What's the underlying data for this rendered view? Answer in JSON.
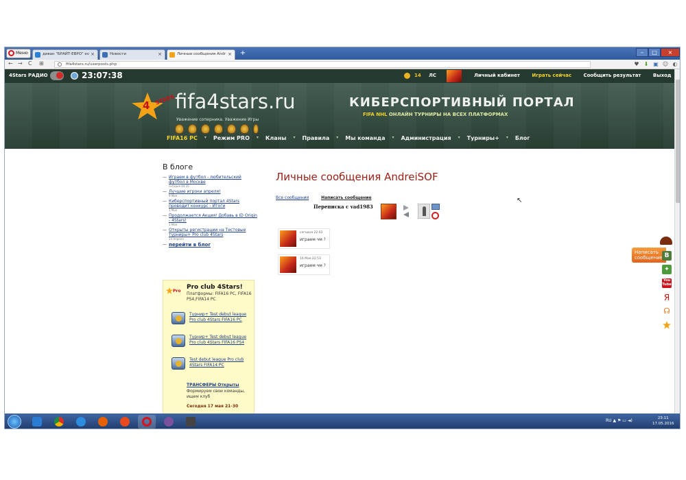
{
  "browser": {
    "menu_label": "Меню",
    "tabs": [
      {
        "label": "диван \"БРАЙТ-ЕВРО\" ev"
      },
      {
        "label": "Новости"
      },
      {
        "label": "Личные сообщения Andr"
      }
    ],
    "url": "fifa4stars.ru/userposts.php"
  },
  "topbar": {
    "radio_label": "4Stars РАДИО",
    "time": "23:07:38",
    "coins": "14",
    "messages_label": "ЛС",
    "links": [
      "Личный кабинет",
      "Играть сейчас",
      "Сообщить результат",
      "Выход"
    ]
  },
  "header": {
    "logo_number": "4",
    "logo_word": "STARS",
    "brand": "fifa4stars.ru",
    "slogan": "Уважение соперника. Уважение Игры",
    "portal_title": "КИБЕРСПОРТИВНЫЙ ПОРТАЛ",
    "portal_sub_a": "FIFA",
    "portal_sub_b": "NHL",
    "portal_sub_c": "ОНЛАЙН ТУРНИРЫ НА ВСЕХ ПЛАТФОРМАХ"
  },
  "nav": {
    "items": [
      "FIFA16 PC",
      "Режим PRO",
      "Кланы",
      "Правила",
      "Мы команда",
      "Администрация",
      "Турниры+",
      "Блог"
    ]
  },
  "blog": {
    "heading": "В блоге",
    "items": [
      {
        "title": "Играем в футбол - любительский футбол в Москве",
        "date": "сегодня 04:35"
      },
      {
        "title": "Лучшие игроки апреля!",
        "date": "9 Мая"
      },
      {
        "title": "Киберспортивный портал 4Stars проводит конкурс - Итоги",
        "date": "3 Мая"
      },
      {
        "title": "Продолжается Акция! Добавь в ID Origin - 4Stars!",
        "date": "1 Мая"
      },
      {
        "title": "Открыты регистрации на Тестовые турниры+ Pro club 4Stars",
        "date": "24 Апреля"
      }
    ],
    "all_link": "перейти в блог"
  },
  "proclub": {
    "tag": "Pro",
    "title": "Pro club 4Stars!",
    "platforms": "Платформы: FIFA16 PC, FIFA16 PS4,FIFA14 PC",
    "links": [
      "Турнир+ Test debut league Pro club 4Stars FIFA16 PC",
      "Турнир+ Test debut league Pro club 4Stars FIFA16 PS4",
      "Test debut league Pro club 4Stars FIFA14 PC"
    ],
    "transfer_title": "ТРАНСФЕРЫ Открыты",
    "transfer_text": "Формируем свои команды, ищем клуб",
    "today": "Сегодня 17 мая 21-30"
  },
  "main": {
    "title": "Личные сообщения AndreiSOF",
    "tab_all": "Все сообщения",
    "tab_write": "Написать сообщение",
    "correspondence": "Переписка с vad1983",
    "messages": [
      {
        "time": "сегодня 22:02",
        "text": "играем чм ?"
      },
      {
        "time": "16 Мая 22:53",
        "text": "играем чм ?"
      }
    ]
  },
  "social": {
    "write_tab": "Написать сообщение",
    "vk": "В",
    "yandex": "Я",
    "youtube": "You Tube"
  },
  "taskbar": {
    "lang": "RU",
    "time": "23:11",
    "date": "17.05.2016"
  }
}
